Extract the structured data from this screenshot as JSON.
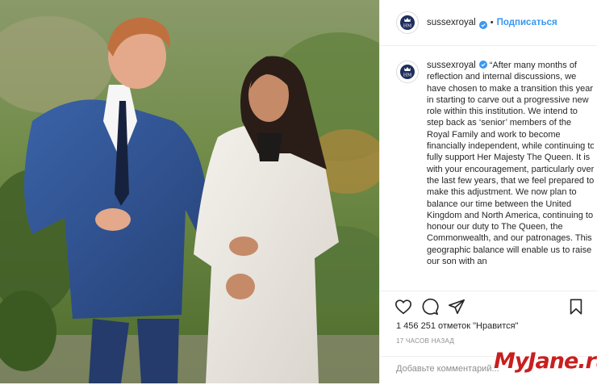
{
  "post": {
    "username": "sussexroyal",
    "follow_label": "Подписаться",
    "separator": "•",
    "caption_username": "sussexroyal",
    "caption_text": "“After many months of reflection and internal discussions, we have chosen to make a transition this year in starting to carve out a progressive new role within this institution. We intend to step back as ‘senior’ members of the Royal Family and work to become financially independent, while continuing to fully support Her Majesty The Queen. It is with your encouragement, particularly over the last few years, that we feel prepared to make this adjustment. We now plan to balance our time between the United Kingdom and North America, continuing to honour our duty to The Queen, the Commonwealth, and our patronages. This geographic balance will enable us to raise our son with an",
    "likes": "1 456 251 отметок \"Нравится\"",
    "time_ago": "17 ЧАСОВ НАЗАД",
    "comment_placeholder": "Добавьте комментарий..."
  },
  "icons": {
    "like": "heart-icon",
    "comment": "comment-icon",
    "share": "share-icon",
    "save": "bookmark-icon",
    "verified": "verified-badge-icon"
  },
  "colors": {
    "link": "#3897f0",
    "verified": "#3897f0",
    "watermark": "#c91f1f"
  },
  "watermark": "MyJane.ru"
}
